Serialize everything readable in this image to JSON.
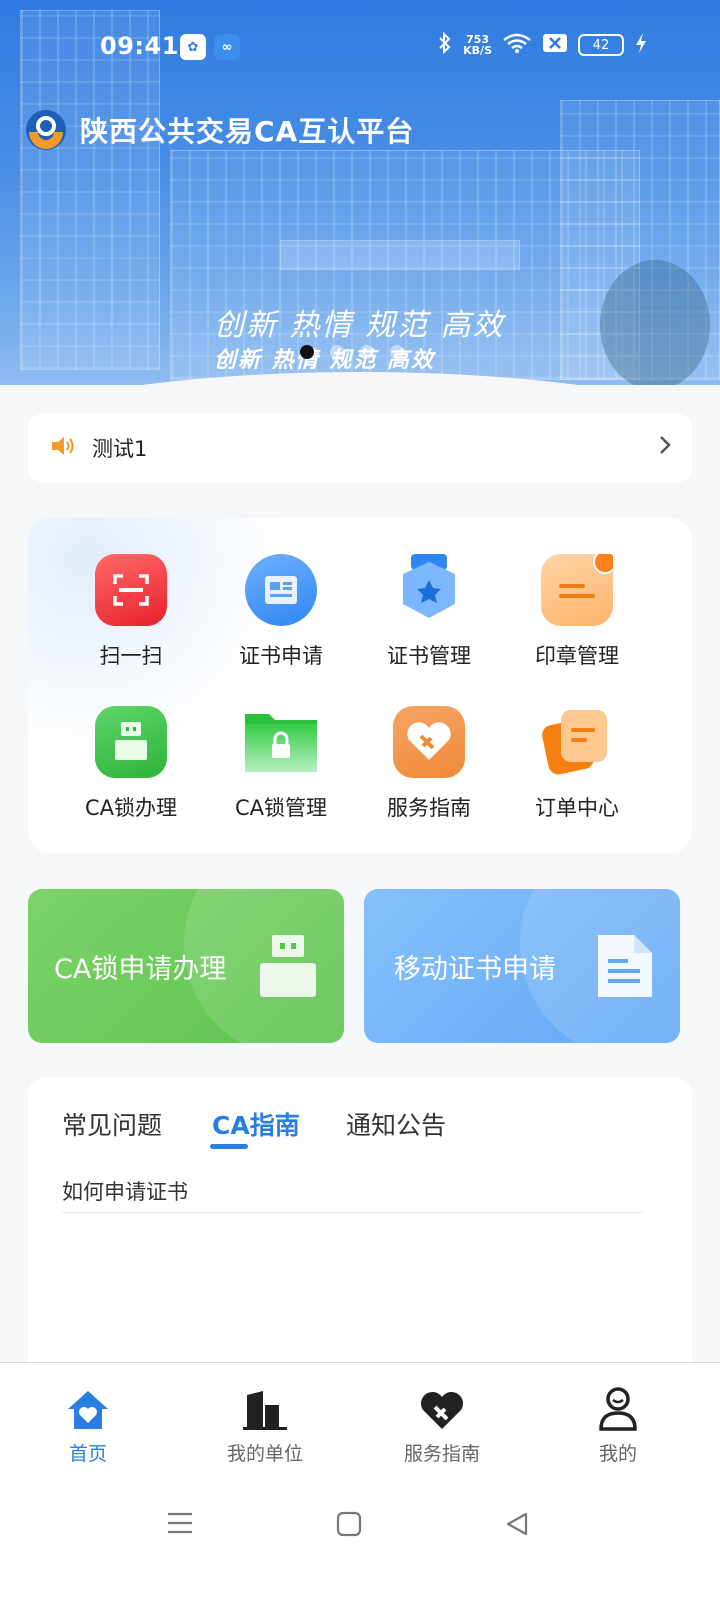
{
  "status_bar": {
    "time": "09:41",
    "net_speed_value": "753",
    "net_speed_unit": "KB/S",
    "battery": "42"
  },
  "header": {
    "title": "陕西公共交易CA互认平台",
    "slogan_line1": "创新 热情 规范 高效",
    "slogan_line2": "创新 热情 规范 高效",
    "carousel_active_index": 0,
    "carousel_count": 4
  },
  "notice": {
    "text": "测试1"
  },
  "grid": {
    "items": [
      {
        "label": "扫一扫",
        "icon": "scan-icon"
      },
      {
        "label": "证书申请",
        "icon": "certificate-apply-icon"
      },
      {
        "label": "证书管理",
        "icon": "certificate-manage-icon"
      },
      {
        "label": "印章管理",
        "icon": "seal-manage-icon"
      },
      {
        "label": "CA锁办理",
        "icon": "usb-key-icon"
      },
      {
        "label": "CA锁管理",
        "icon": "folder-lock-icon"
      },
      {
        "label": "服务指南",
        "icon": "service-guide-icon"
      },
      {
        "label": "订单中心",
        "icon": "order-center-icon"
      }
    ]
  },
  "promos": {
    "left": {
      "label": "CA锁申请办理",
      "icon": "usb-key-icon"
    },
    "right": {
      "label": "移动证书申请",
      "icon": "document-icon"
    }
  },
  "tabs": {
    "items": [
      "常见问题",
      "CA指南",
      "通知公告"
    ],
    "active": "CA指南",
    "list": [
      "如何申请证书"
    ]
  },
  "bottom_nav": {
    "items": [
      {
        "label": "首页",
        "icon": "home-heart-icon"
      },
      {
        "label": "我的单位",
        "icon": "building-icon"
      },
      {
        "label": "服务指南",
        "icon": "handshake-heart-icon"
      },
      {
        "label": "我的",
        "icon": "user-icon"
      }
    ],
    "active": "首页"
  },
  "colors": {
    "brand_blue": "#2a7de1",
    "green": "#5bc24d",
    "light_blue": "#62a8f5",
    "orange": "#f39a2b"
  }
}
